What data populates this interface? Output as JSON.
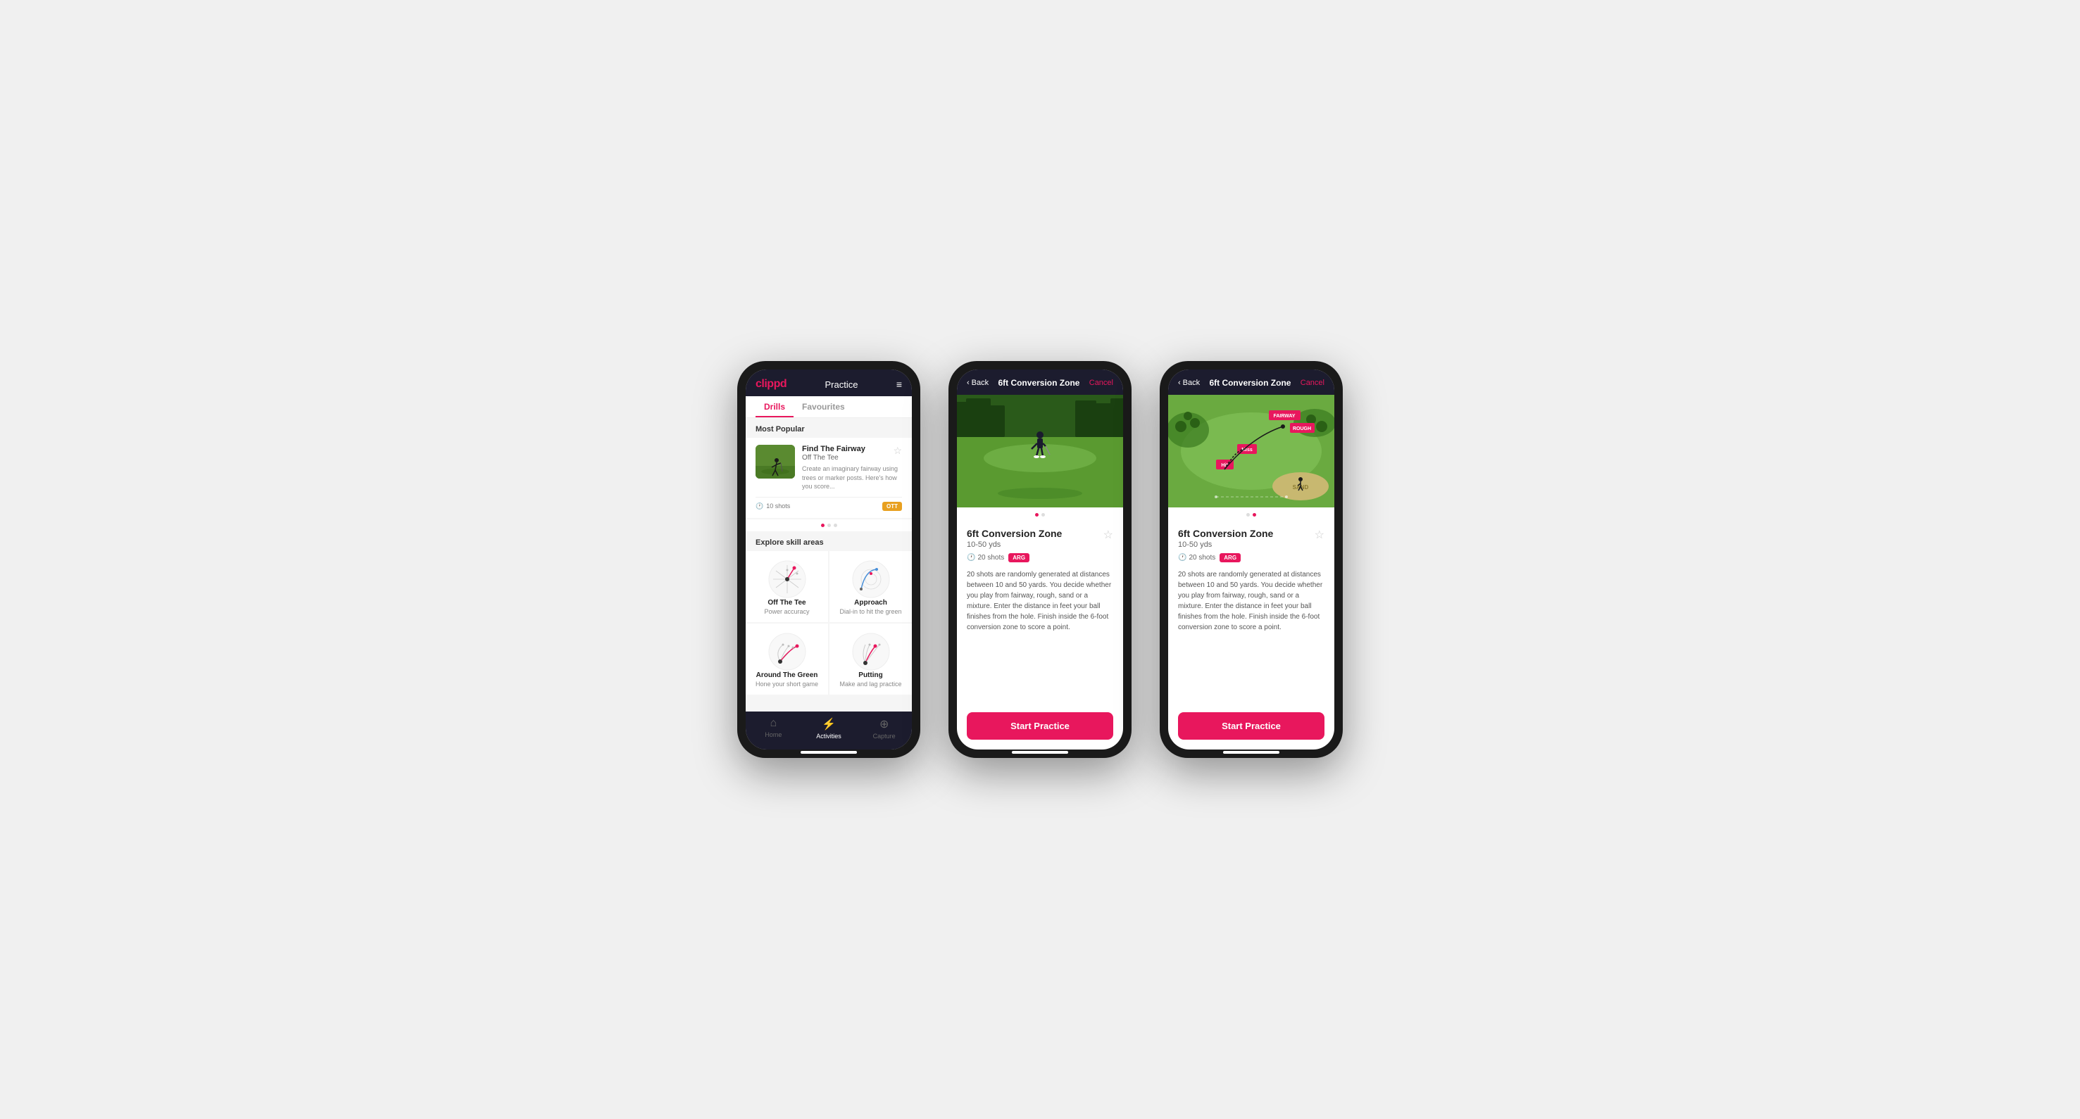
{
  "phone1": {
    "header": {
      "logo": "clippd",
      "title": "Practice",
      "menu_icon": "≡"
    },
    "tabs": [
      {
        "label": "Drills",
        "active": true
      },
      {
        "label": "Favourites",
        "active": false
      }
    ],
    "most_popular_title": "Most Popular",
    "featured_card": {
      "name": "Find The Fairway",
      "sub": "Off The Tee",
      "description": "Create an imaginary fairway using trees or marker posts. Here's how you score...",
      "shots": "10 shots",
      "badge": "OTT"
    },
    "explore_title": "Explore skill areas",
    "skills": [
      {
        "name": "Off The Tee",
        "desc": "Power accuracy"
      },
      {
        "name": "Approach",
        "desc": "Dial-in to hit the green"
      },
      {
        "name": "Around The Green",
        "desc": "Hone your short game"
      },
      {
        "name": "Putting",
        "desc": "Make and lag practice"
      }
    ],
    "nav": [
      {
        "label": "Home",
        "icon": "⌂",
        "active": false
      },
      {
        "label": "Activities",
        "icon": "⚡",
        "active": true
      },
      {
        "label": "Capture",
        "icon": "⊕",
        "active": false
      }
    ]
  },
  "phone2": {
    "header": {
      "back_label": "Back",
      "title": "6ft Conversion Zone",
      "cancel_label": "Cancel"
    },
    "drill": {
      "name": "6ft Conversion Zone",
      "distance": "10-50 yds",
      "shots": "20 shots",
      "badge": "ARG",
      "description": "20 shots are randomly generated at distances between 10 and 50 yards. You decide whether you play from fairway, rough, sand or a mixture. Enter the distance in feet your ball finishes from the hole. Finish inside the 6-foot conversion zone to score a point."
    },
    "start_button": "Start Practice",
    "dots": [
      {
        "active": true
      },
      {
        "active": false
      }
    ]
  },
  "phone3": {
    "header": {
      "back_label": "Back",
      "title": "6ft Conversion Zone",
      "cancel_label": "Cancel"
    },
    "drill": {
      "name": "6ft Conversion Zone",
      "distance": "10-50 yds",
      "shots": "20 shots",
      "badge": "ARG",
      "description": "20 shots are randomly generated at distances between 10 and 50 yards. You decide whether you play from fairway, rough, sand or a mixture. Enter the distance in feet your ball finishes from the hole. Finish inside the 6-foot conversion zone to score a point."
    },
    "start_button": "Start Practice",
    "dots": [
      {
        "active": false
      },
      {
        "active": true
      }
    ]
  }
}
